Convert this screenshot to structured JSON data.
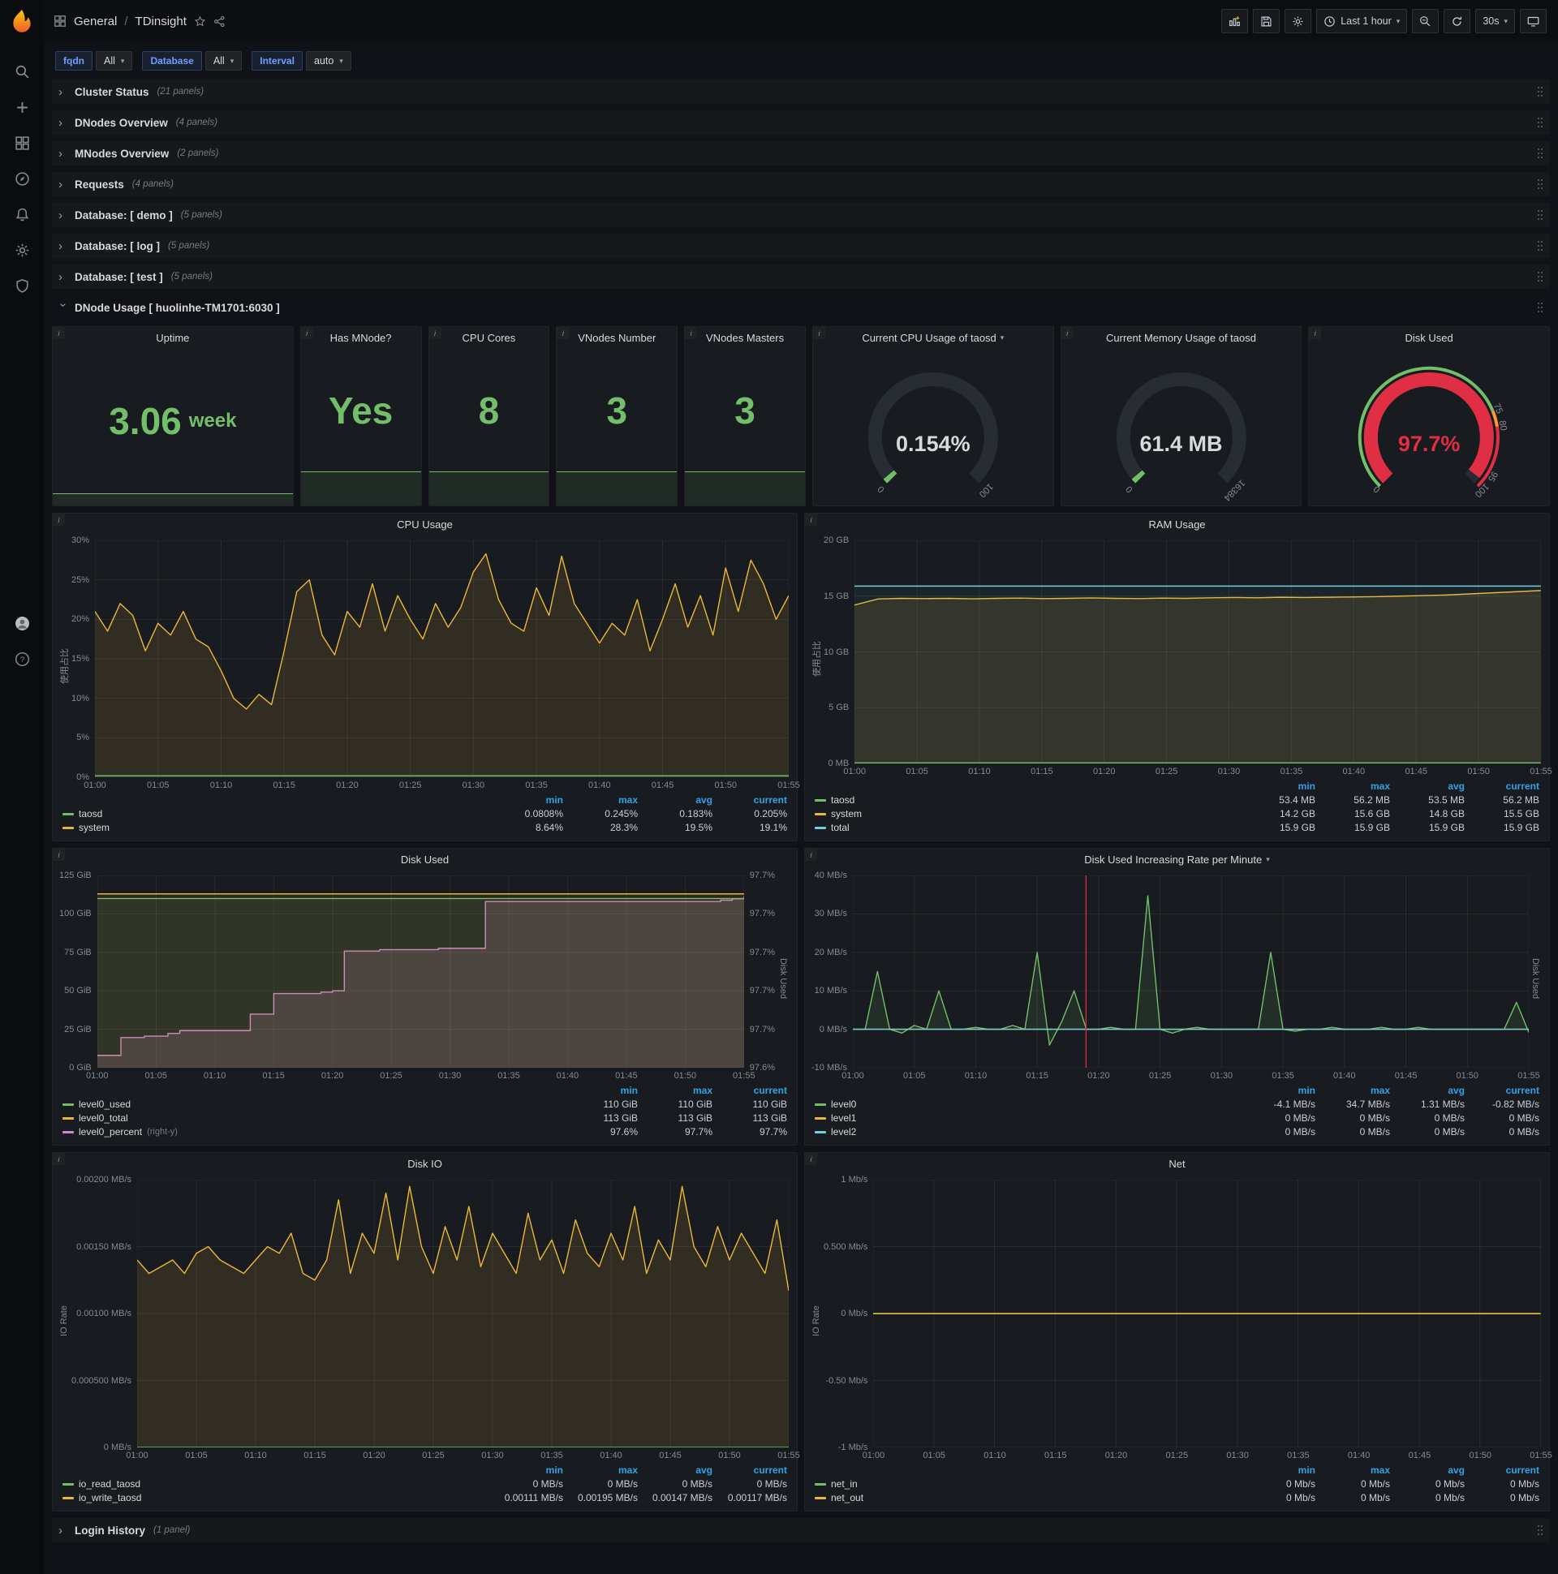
{
  "topnav": {
    "breadcrumb_section": "General",
    "breadcrumb_sep": "/",
    "breadcrumb_title": "TDinsight",
    "time_range_label": "Last 1 hour",
    "refresh_value": "30s"
  },
  "variables": [
    {
      "label": "fqdn",
      "value": "All"
    },
    {
      "label": "Database",
      "value": "All"
    },
    {
      "label": "Interval",
      "value": "auto"
    }
  ],
  "rows": {
    "collapsed_top": [
      {
        "title": "Cluster Status",
        "count": "(21 panels)"
      },
      {
        "title": "DNodes Overview",
        "count": "(4 panels)"
      },
      {
        "title": "MNodes Overview",
        "count": "(2 panels)"
      },
      {
        "title": "Requests",
        "count": "(4 panels)"
      },
      {
        "title": "Database: [ demo ]",
        "count": "(5 panels)"
      },
      {
        "title": "Database: [ log ]",
        "count": "(5 panels)"
      },
      {
        "title": "Database: [ test ]",
        "count": "(5 panels)"
      }
    ],
    "expanded_title": "DNode Usage [ huolinhe-TM1701:6030 ]",
    "collapsed_bottom": {
      "title": "Login History",
      "count": "(1 panel)"
    }
  },
  "stat_panels": [
    {
      "title": "Uptime",
      "value": "3.06",
      "suffix": "week",
      "w": 2,
      "spark_h": 15
    },
    {
      "title": "Has MNode?",
      "value": "Yes",
      "suffix": "",
      "w": 1,
      "spark_h": 42
    },
    {
      "title": "CPU Cores",
      "value": "8",
      "suffix": "",
      "w": 1,
      "spark_h": 42
    },
    {
      "title": "VNodes Number",
      "value": "3",
      "suffix": "",
      "w": 1,
      "spark_h": 42
    },
    {
      "title": "VNodes Masters",
      "value": "3",
      "suffix": "",
      "w": 1,
      "spark_h": 42
    }
  ],
  "gauge_panels": [
    {
      "title": "Current CPU Usage of taosd",
      "has_menu": true,
      "display": "0.154%",
      "fraction": 0.00154,
      "value_color": "#d8d9da",
      "arc_color": "#73bf69",
      "scale_labels": [
        {
          "f": 0,
          "t": "0"
        },
        {
          "f": 1,
          "t": "100"
        }
      ]
    },
    {
      "title": "Current Memory Usage of taosd",
      "display": "61.4 MB",
      "fraction": 0.00375,
      "value_color": "#d8d9da",
      "arc_color": "#73bf69",
      "scale_labels": [
        {
          "f": 0,
          "t": "0"
        },
        {
          "f": 1,
          "t": "16384"
        }
      ]
    },
    {
      "title": "Disk Used",
      "display": "97.7%",
      "fraction": 0.977,
      "value_color": "#e02f44",
      "arc_color": "#e02f44",
      "bands": [
        {
          "f0": 0,
          "f1": 0.75,
          "color": "#73bf69"
        },
        {
          "f0": 0.75,
          "f1": 0.8,
          "color": "#ff9830"
        },
        {
          "f0": 0.8,
          "f1": 1,
          "color": "#e02f44"
        }
      ],
      "scale_labels": [
        {
          "f": 0,
          "t": "0"
        },
        {
          "f": 0.75,
          "t": "75"
        },
        {
          "f": 0.8,
          "t": "80"
        },
        {
          "f": 0.95,
          "t": "95"
        },
        {
          "f": 1,
          "t": "100"
        }
      ]
    }
  ],
  "x_ticks": [
    "01:00",
    "01:05",
    "01:10",
    "01:15",
    "01:20",
    "01:25",
    "01:30",
    "01:35",
    "01:40",
    "01:45",
    "01:50",
    "01:55"
  ],
  "charts": [
    {
      "id": "cpu-usage",
      "title": "CPU Usage",
      "y_label": "使用占比",
      "y_ticks": [
        "30%",
        "25%",
        "20%",
        "15%",
        "10%",
        "5%",
        "0%"
      ],
      "ylim": [
        0,
        30
      ],
      "series": [
        {
          "name": "system",
          "color": "#eab839",
          "fill": 0.12,
          "values": [
            21.0,
            18.5,
            22.0,
            20.5,
            16.0,
            19.5,
            18.0,
            21.0,
            17.5,
            16.5,
            13.5,
            10.0,
            8.64,
            10.5,
            9.2,
            16.0,
            23.5,
            25.0,
            18.0,
            15.5,
            21.0,
            19.0,
            24.5,
            18.5,
            23.0,
            20.0,
            17.5,
            22.0,
            19.0,
            21.5,
            26.0,
            28.3,
            22.5,
            19.5,
            18.5,
            24.0,
            20.5,
            28.0,
            22.0,
            19.5,
            17.0,
            19.5,
            18.0,
            22.5,
            16.0,
            20.0,
            24.5,
            19.0,
            23.0,
            18.0,
            26.5,
            21.0,
            27.5,
            24.5,
            20.0,
            23.0
          ]
        },
        {
          "name": "taosd",
          "color": "#73bf69",
          "fill": 0.15,
          "values": [
            0.2,
            0.2
          ]
        }
      ],
      "legend": {
        "columns": [
          "min",
          "max",
          "avg",
          "current"
        ],
        "rows": [
          {
            "name": "taosd",
            "color": "#73bf69",
            "values": [
              "0.0808%",
              "0.245%",
              "0.183%",
              "0.205%"
            ]
          },
          {
            "name": "system",
            "color": "#eab839",
            "values": [
              "8.64%",
              "28.3%",
              "19.5%",
              "19.1%"
            ]
          }
        ]
      }
    },
    {
      "id": "ram-usage",
      "title": "RAM Usage",
      "y_label": "使用占比",
      "y_ticks": [
        "20 GB",
        "15 GB",
        "10 GB",
        "5 GB",
        "0 MB"
      ],
      "ylim": [
        0,
        20
      ],
      "series": [
        {
          "name": "system",
          "color": "#eab839",
          "fill": 0.12,
          "values": [
            14.2,
            14.75,
            14.8,
            14.78,
            14.8,
            14.76,
            14.8,
            14.82,
            14.78,
            14.8,
            14.84,
            14.8,
            14.78,
            14.82,
            14.8,
            14.85,
            14.88,
            14.85,
            14.9,
            14.88,
            14.9,
            14.92,
            14.95,
            15.0,
            15.05,
            15.1,
            15.2,
            15.3,
            15.4,
            15.5
          ]
        },
        {
          "name": "total",
          "color": "#6ed0e0",
          "fill": 0.06,
          "values": [
            15.9,
            15.9
          ]
        },
        {
          "name": "taosd",
          "color": "#73bf69",
          "fill": 0.1,
          "values": [
            0.053,
            0.053
          ]
        }
      ],
      "legend": {
        "columns": [
          "min",
          "max",
          "avg",
          "current"
        ],
        "rows": [
          {
            "name": "taosd",
            "color": "#73bf69",
            "values": [
              "53.4 MB",
              "56.2 MB",
              "53.5 MB",
              "56.2 MB"
            ]
          },
          {
            "name": "system",
            "color": "#eab839",
            "values": [
              "14.2 GB",
              "15.6 GB",
              "14.8 GB",
              "15.5 GB"
            ]
          },
          {
            "name": "total",
            "color": "#6ed0e0",
            "values": [
              "15.9 GB",
              "15.9 GB",
              "15.9 GB",
              "15.9 GB"
            ]
          }
        ]
      }
    },
    {
      "id": "disk-used",
      "title": "Disk Used",
      "y_ticks": [
        "125 GiB",
        "100 GiB",
        "75 GiB",
        "50 GiB",
        "25 GiB",
        "0 GiB"
      ],
      "ylim": [
        0,
        125
      ],
      "y_ticks_right": [
        "97.7%",
        "97.7%",
        "97.7%",
        "97.7%",
        "97.7%",
        "97.6%"
      ],
      "y_label_right": "Disk Used",
      "series": [
        {
          "name": "level0_percent",
          "color": "#d683ce",
          "fill": 0.18,
          "step": true,
          "ylim": [
            97.58,
            97.72
          ],
          "values": [
            97.589,
            97.589,
            97.602,
            97.602,
            97.603,
            97.603,
            97.605,
            97.607,
            97.607,
            97.607,
            97.607,
            97.607,
            97.607,
            97.619,
            97.619,
            97.634,
            97.634,
            97.634,
            97.634,
            97.635,
            97.636,
            97.665,
            97.665,
            97.665,
            97.666,
            97.666,
            97.666,
            97.666,
            97.666,
            97.667,
            97.667,
            97.667,
            97.667,
            97.701,
            97.701,
            97.701,
            97.701,
            97.701,
            97.701,
            97.701,
            97.701,
            97.701,
            97.701,
            97.701,
            97.701,
            97.701,
            97.701,
            97.701,
            97.701,
            97.701,
            97.701,
            97.701,
            97.701,
            97.702,
            97.703,
            97.705
          ]
        },
        {
          "name": "level0_used",
          "color": "#73bf69",
          "fill": 0.1,
          "values": [
            110,
            110
          ]
        },
        {
          "name": "level0_total",
          "color": "#eab839",
          "fill": 0.08,
          "values": [
            113,
            113
          ]
        }
      ],
      "legend": {
        "columns": [
          "min",
          "max",
          "current"
        ],
        "rows": [
          {
            "name": "level0_used",
            "color": "#73bf69",
            "values": [
              "110 GiB",
              "110 GiB",
              "110 GiB"
            ]
          },
          {
            "name": "level0_total",
            "color": "#eab839",
            "values": [
              "113 GiB",
              "113 GiB",
              "113 GiB"
            ]
          },
          {
            "name": "level0_percent",
            "color": "#d683ce",
            "suffix": "(right-y)",
            "values": [
              "97.6%",
              "97.7%",
              "97.7%"
            ]
          }
        ]
      }
    },
    {
      "id": "disk-rate",
      "title": "Disk Used Increasing Rate per Minute",
      "has_menu": true,
      "y_ticks": [
        "40 MB/s",
        "30 MB/s",
        "20 MB/s",
        "10 MB/s",
        "0 MB/s",
        "-10 MB/s"
      ],
      "ylim": [
        -10,
        40
      ],
      "y_label_right": "Disk Used",
      "annotation_x": 0.345,
      "series": [
        {
          "name": "level0",
          "color": "#73bf69",
          "fill": 0.12,
          "values": [
            0,
            0,
            15,
            0,
            -1,
            1,
            0,
            10,
            0,
            0,
            0.5,
            0,
            0,
            1,
            0,
            20,
            -4.1,
            2,
            10,
            0,
            0,
            0.5,
            0,
            0,
            34.7,
            0,
            -1,
            0,
            0.5,
            0,
            0,
            0,
            0,
            0,
            20,
            0,
            -0.5,
            0,
            0,
            0.5,
            0,
            0,
            0,
            0.5,
            0,
            0,
            0.5,
            0,
            0,
            0,
            0,
            0,
            0,
            0,
            7,
            -0.82
          ]
        },
        {
          "name": "level1",
          "color": "#eab839",
          "values": [
            0,
            0
          ]
        },
        {
          "name": "level2",
          "color": "#6ed0e0",
          "values": [
            0,
            0
          ]
        }
      ],
      "legend": {
        "columns": [
          "min",
          "max",
          "avg",
          "current"
        ],
        "rows": [
          {
            "name": "level0",
            "color": "#73bf69",
            "values": [
              "-4.1 MB/s",
              "34.7 MB/s",
              "1.31 MB/s",
              "-0.82 MB/s"
            ]
          },
          {
            "name": "level1",
            "color": "#eab839",
            "values": [
              "0 MB/s",
              "0 MB/s",
              "0 MB/s",
              "0 MB/s"
            ]
          },
          {
            "name": "level2",
            "color": "#6ed0e0",
            "values": [
              "0 MB/s",
              "0 MB/s",
              "0 MB/s",
              "0 MB/s"
            ]
          }
        ]
      }
    },
    {
      "id": "disk-io",
      "title": "Disk IO",
      "y_label": "IO Rate",
      "y_ticks": [
        "0.00200 MB/s",
        "0.00150 MB/s",
        "0.00100 MB/s",
        "0.000500 MB/s",
        "0 MB/s"
      ],
      "ylim": [
        0,
        0.002
      ],
      "series": [
        {
          "name": "io_write_taosd",
          "color": "#eab839",
          "fill": 0.12,
          "values": [
            0.0014,
            0.0013,
            0.00135,
            0.0014,
            0.0013,
            0.00145,
            0.0015,
            0.0014,
            0.00135,
            0.0013,
            0.0014,
            0.0015,
            0.00145,
            0.0016,
            0.0013,
            0.00125,
            0.0014,
            0.00185,
            0.0013,
            0.0016,
            0.00145,
            0.0019,
            0.0014,
            0.00195,
            0.0015,
            0.0013,
            0.00165,
            0.0014,
            0.0018,
            0.00135,
            0.0016,
            0.00145,
            0.0013,
            0.00175,
            0.0014,
            0.00155,
            0.0013,
            0.0017,
            0.00145,
            0.00135,
            0.0016,
            0.0014,
            0.0018,
            0.0013,
            0.00155,
            0.0014,
            0.00195,
            0.0015,
            0.00135,
            0.00165,
            0.0014,
            0.0016,
            0.00145,
            0.0013,
            0.0017,
            0.00117
          ]
        },
        {
          "name": "io_read_taosd",
          "color": "#73bf69",
          "values": [
            0,
            0
          ]
        }
      ],
      "legend": {
        "columns": [
          "min",
          "max",
          "avg",
          "current"
        ],
        "rows": [
          {
            "name": "io_read_taosd",
            "color": "#73bf69",
            "values": [
              "0 MB/s",
              "0 MB/s",
              "0 MB/s",
              "0 MB/s"
            ]
          },
          {
            "name": "io_write_taosd",
            "color": "#eab839",
            "values": [
              "0.00111 MB/s",
              "0.00195 MB/s",
              "0.00147 MB/s",
              "0.00117 MB/s"
            ]
          }
        ]
      }
    },
    {
      "id": "net",
      "title": "Net",
      "y_label": "IO Rate",
      "y_ticks": [
        "1 Mb/s",
        "0.500 Mb/s",
        "0 Mb/s",
        "-0.50 Mb/s",
        "-1 Mb/s"
      ],
      "ylim": [
        -1,
        1
      ],
      "series": [
        {
          "name": "net_in",
          "color": "#73bf69",
          "values": [
            0,
            0
          ]
        },
        {
          "name": "net_out",
          "color": "#eab839",
          "values": [
            0,
            0
          ]
        }
      ],
      "legend": {
        "columns": [
          "min",
          "max",
          "avg",
          "current"
        ],
        "rows": [
          {
            "name": "net_in",
            "color": "#73bf69",
            "values": [
              "0 Mb/s",
              "0 Mb/s",
              "0 Mb/s",
              "0 Mb/s"
            ]
          },
          {
            "name": "net_out",
            "color": "#eab839",
            "values": [
              "0 Mb/s",
              "0 Mb/s",
              "0 Mb/s",
              "0 Mb/s"
            ]
          }
        ]
      }
    }
  ]
}
